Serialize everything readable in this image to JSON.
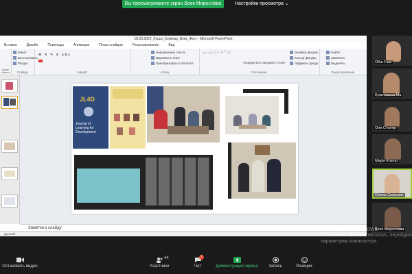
{
  "banner": {
    "sharing_text": "Вы просматриваете экран Воек Мирослава",
    "view_options": "Настройки просмотра"
  },
  "ppt": {
    "title": "18.03.2022_Луцьк_Семінар_Воек_Фест - Microsoft PowerPoint",
    "menu": [
      "Вставка",
      "Дизайн",
      "Переходы",
      "Анимация",
      "Показ слайдов",
      "Рецензирование",
      "Вид"
    ],
    "ribbon": {
      "clipboard_label": "Буфер обмена",
      "slides_label": "Слайды",
      "slides_items": [
        "Макет",
        "Восстановить",
        "Раздел"
      ],
      "font_label": "Шрифт",
      "paragraph_label": "Абзац",
      "paragraph_items": [
        "Направление текста",
        "Выровнять текст",
        "Преобразовать в SmartArt"
      ],
      "drawing_label": "Рисование",
      "arrange": "Упорядочить",
      "quick_styles": "Экспресс-стили",
      "shape_items": [
        "Заливка фигуры",
        "Контур фигуры",
        "Эффекты фигур"
      ],
      "editing_label": "Редактирование",
      "editing_items": [
        "Найти",
        "Заменить",
        "Выделить"
      ]
    },
    "slide": {
      "journal_line1": "Journal of",
      "journal_line2": "Learning for",
      "journal_line3": "Development",
      "journal_logo": "JL4D"
    },
    "notes_placeholder": "Заметки к слайду",
    "status_language": "русский"
  },
  "participants": [
    {
      "name": "Olha Fast"
    },
    {
      "name": "Кульчицька Ма"
    },
    {
      "name": "Оля Столяр"
    },
    {
      "name": "Марія Козгор"
    },
    {
      "name": "Олена Семенюк"
    },
    {
      "name": "Воек Мирослава"
    }
  ],
  "watermark": {
    "line1": "Активация Windows",
    "line2": "Чтобы активировать Windows, перейдите к",
    "line3": "параметрам компьютера."
  },
  "toolbar": {
    "stop_video": "Остановить видео",
    "participants_count": "44",
    "participants": "Участники",
    "chat_badge": "1",
    "chat": "Чат",
    "share_screen": "Демонстрация экрана",
    "record": "Запись",
    "reactions": "Реакции"
  },
  "colors": {
    "banner_green": "#1ea451",
    "active_speaker": "#9fcf3f",
    "chat_badge": "#e8442e"
  }
}
